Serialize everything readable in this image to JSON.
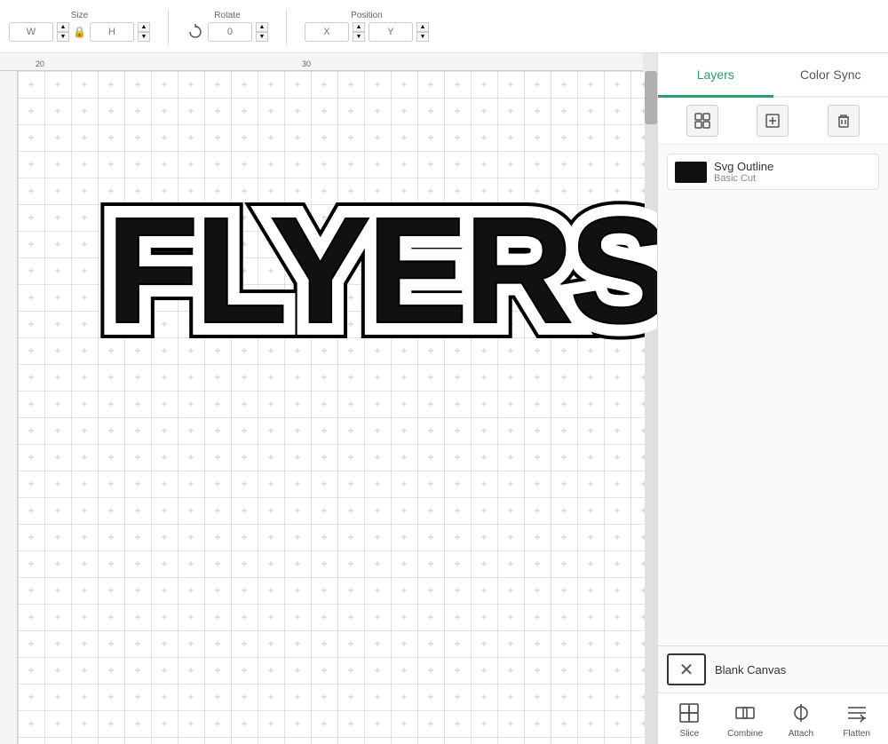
{
  "toolbar": {
    "size_label": "Size",
    "size_w_placeholder": "W",
    "size_h_placeholder": "H",
    "rotate_label": "Rotate",
    "rotate_placeholder": "0",
    "position_label": "Position",
    "position_x_placeholder": "X",
    "position_y_placeholder": "Y"
  },
  "ruler": {
    "marks": [
      "20",
      "30"
    ]
  },
  "canvas": {
    "text": "FLYERS",
    "bg_color": "#ffffff"
  },
  "panel": {
    "tabs": [
      {
        "id": "layers",
        "label": "Layers",
        "active": true
      },
      {
        "id": "color-sync",
        "label": "Color Sync",
        "active": false
      }
    ],
    "toolbar_icons": [
      {
        "id": "group",
        "symbol": "⊞"
      },
      {
        "id": "add",
        "symbol": "+"
      },
      {
        "id": "delete",
        "symbol": "🗑"
      }
    ],
    "layer": {
      "name": "Svg Outline",
      "type": "Basic Cut"
    },
    "blank_canvas": {
      "label": "Blank Canvas"
    },
    "bottom_actions": [
      {
        "id": "slice",
        "label": "Slice"
      },
      {
        "id": "combine",
        "label": "Combine"
      },
      {
        "id": "attach",
        "label": "Attach"
      },
      {
        "id": "flatten",
        "label": "Flatten"
      }
    ]
  }
}
